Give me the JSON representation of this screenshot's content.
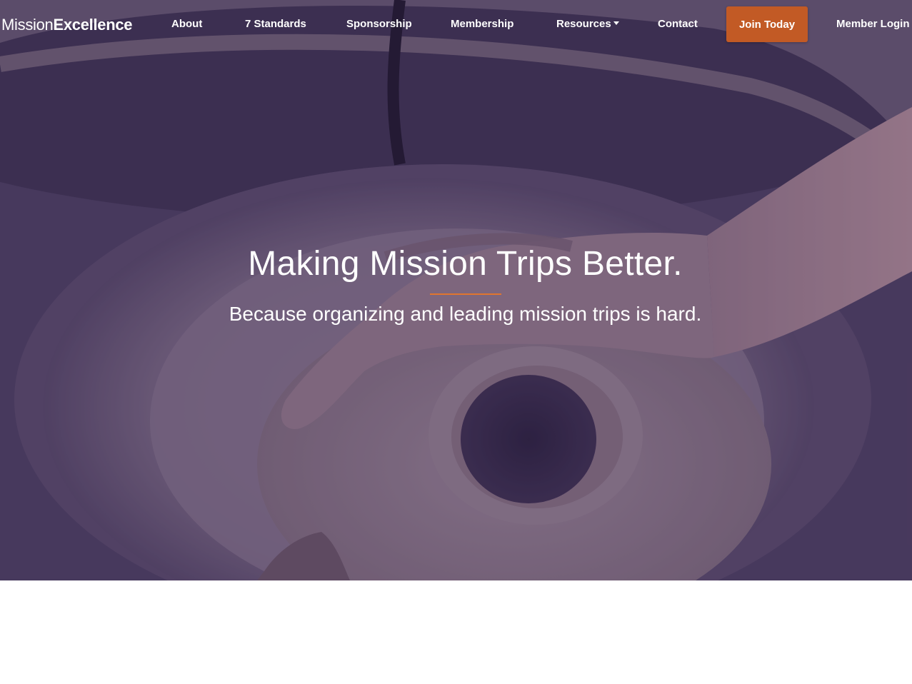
{
  "brand": {
    "name_light": "Mission",
    "name_bold": "Excellence"
  },
  "nav": {
    "items": [
      {
        "label": "About"
      },
      {
        "label": "7 Standards"
      },
      {
        "label": "Sponsorship"
      },
      {
        "label": "Membership"
      },
      {
        "label": "Resources",
        "has_dropdown": true
      },
      {
        "label": "Contact"
      }
    ],
    "cta_label": "Join Today",
    "login_label": "Member Login"
  },
  "hero": {
    "title": "Making Mission Trips Better.",
    "subtitle": "Because organizing and leading mission trips is hard.",
    "background_icon": "pottery-wheel-photo"
  },
  "colors": {
    "accent": "#c25a25",
    "rule": "#e0752f",
    "overlay": "#5b4d6d",
    "text": "#ffffff"
  }
}
